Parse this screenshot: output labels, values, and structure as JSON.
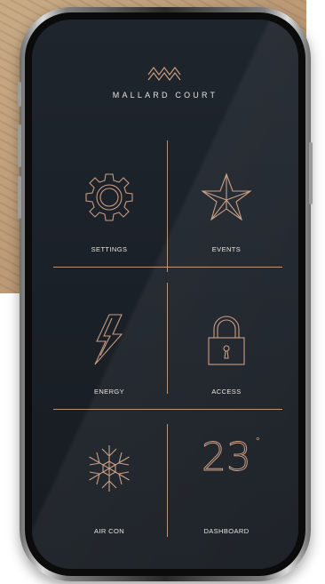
{
  "brand": {
    "name": "MALLARD COURT"
  },
  "tiles": [
    {
      "label": "SETTINGS",
      "icon": "gear-icon"
    },
    {
      "label": "EVENTS",
      "icon": "star-icon"
    },
    {
      "label": "ENERGY",
      "icon": "lightning-icon"
    },
    {
      "label": "ACCESS",
      "icon": "padlock-icon"
    },
    {
      "label": "AIR CON",
      "icon": "snowflake-icon"
    },
    {
      "label": "DASHBOARD",
      "icon": "temperature-display"
    }
  ],
  "temperature": {
    "value": "23",
    "unit": "°"
  },
  "colors": {
    "accent": "#c89b82",
    "screen": "#1c2229",
    "text": "#e8e4df"
  }
}
